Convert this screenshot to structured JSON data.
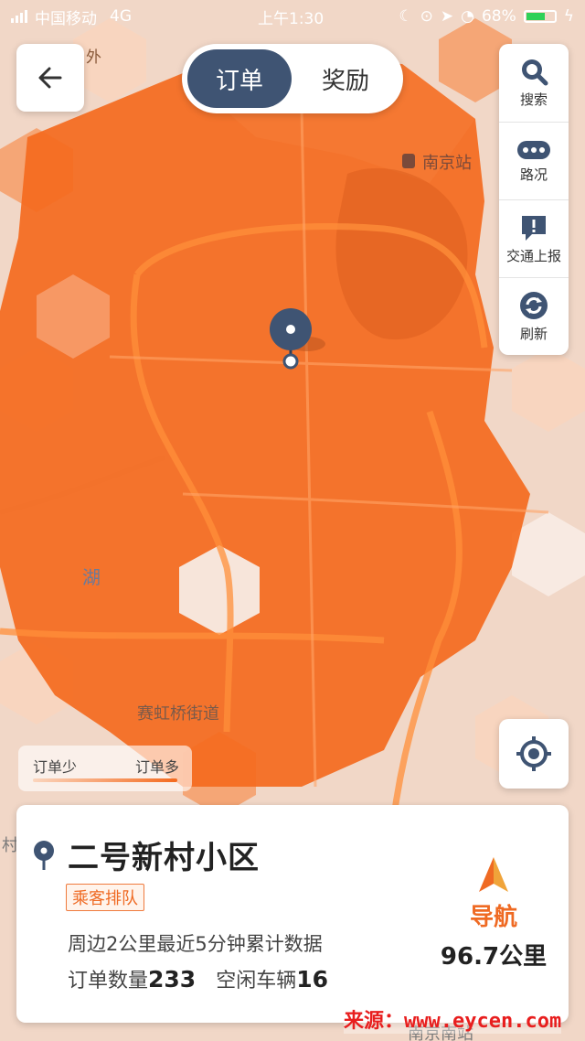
{
  "status_bar": {
    "carrier": "中国移动",
    "network": "4G",
    "time": "上午1:30",
    "battery": "68%",
    "battery_level": 0.68
  },
  "header": {
    "tabs": [
      {
        "label": "订单",
        "active": true
      },
      {
        "label": "奖励",
        "active": false
      }
    ]
  },
  "toolbar": {
    "items": [
      {
        "label": "搜索",
        "icon": "search-icon"
      },
      {
        "label": "路况",
        "icon": "traffic-icon"
      },
      {
        "label": "交通上报",
        "icon": "report-icon"
      },
      {
        "label": "刷新",
        "icon": "refresh-icon"
      }
    ]
  },
  "map": {
    "labels": {
      "top_left": "外",
      "station": "南京站",
      "lake": "湖",
      "street": "赛虹桥街道",
      "left_edge": "村",
      "bottom": "南京南站"
    }
  },
  "legend": {
    "low": "订单少",
    "high": "订单多"
  },
  "info": {
    "place": "二号新村小区",
    "badge": "乘客排队",
    "desc": "周边2公里最近5分钟累计数据",
    "orders_label": "订单数量",
    "orders_value": "233",
    "idle_label": "空闲车辆",
    "idle_value": "16",
    "nav_label": "导航",
    "distance": "96.7公里"
  },
  "watermark": "来源：www.eycen.com",
  "colors": {
    "heat_high": "#f46a1e",
    "heat_mid": "#f79a62",
    "heat_low": "#fbd5bd",
    "accent_dark": "#3f5473",
    "accent_orange": "#ef6a23"
  }
}
